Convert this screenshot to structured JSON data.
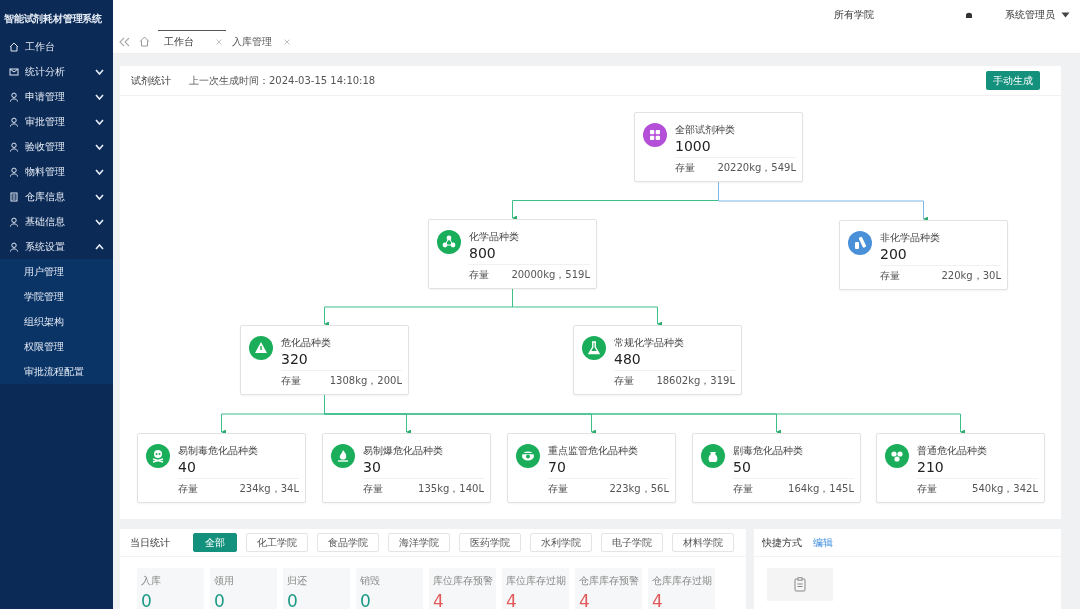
{
  "app_title": "智能试剂耗材管理系统",
  "sidebar": {
    "items": [
      {
        "label": "工作台"
      },
      {
        "label": "统计分析",
        "expanded": false
      },
      {
        "label": "申请管理",
        "expanded": false
      },
      {
        "label": "审批管理",
        "expanded": false
      },
      {
        "label": "验收管理",
        "expanded": false
      },
      {
        "label": "物料管理",
        "expanded": false
      },
      {
        "label": "仓库信息",
        "expanded": false
      },
      {
        "label": "基础信息",
        "expanded": false
      },
      {
        "label": "系统设置",
        "expanded": true,
        "children": [
          {
            "label": "用户管理"
          },
          {
            "label": "学院管理"
          },
          {
            "label": "组织架构"
          },
          {
            "label": "权限管理"
          },
          {
            "label": "审批流程配置"
          }
        ]
      }
    ]
  },
  "header": {
    "college": "所有学院",
    "user": "系统管理员"
  },
  "tabs": [
    {
      "label": "工作台",
      "selected": true
    },
    {
      "label": "入库管理",
      "selected": false
    }
  ],
  "reagent_stats": {
    "title": "试剂统计",
    "last_generated": "上一次生成时间：2024-03-15 14:10:18",
    "button": "手动生成",
    "tree": {
      "label": "全部试剂种类",
      "count": "1000",
      "stock_label": "存量",
      "stock": "20220kg，549L",
      "color": "#b44fd8",
      "children": [
        {
          "label": "化学品种类",
          "count": "800",
          "stock_label": "存量",
          "stock": "20000kg，519L",
          "color": "#1aad5a",
          "children": [
            {
              "label": "危化品种类",
              "count": "320",
              "stock_label": "存量",
              "stock": "1308kg，200L",
              "color": "#1aad5a",
              "children": [
                {
                  "label": "易制毒危化品种类",
                  "count": "40",
                  "stock_label": "存量",
                  "stock": "234kg，34L",
                  "color": "#1aad5a"
                },
                {
                  "label": "易制爆危化品种类",
                  "count": "30",
                  "stock_label": "存量",
                  "stock": "135kg，140L",
                  "color": "#1aad5a"
                },
                {
                  "label": "重点监管危化品种类",
                  "count": "70",
                  "stock_label": "存量",
                  "stock": "223kg，56L",
                  "color": "#1aad5a"
                },
                {
                  "label": "剧毒危化品种类",
                  "count": "50",
                  "stock_label": "存量",
                  "stock": "164kg，145L",
                  "color": "#1aad5a"
                },
                {
                  "label": "普通危化品种类",
                  "count": "210",
                  "stock_label": "存量",
                  "stock": "540kg，342L",
                  "color": "#1aad5a"
                }
              ]
            },
            {
              "label": "常规化学品种类",
              "count": "480",
              "stock_label": "存量",
              "stock": "18602kg，319L",
              "color": "#1aad5a"
            }
          ]
        },
        {
          "label": "非化学品种类",
          "count": "200",
          "stock_label": "存量",
          "stock": "220kg，30L",
          "color": "#4a90d9"
        }
      ]
    }
  },
  "daily_stats": {
    "title": "当日统计",
    "filters": [
      {
        "label": "全部",
        "selected": true
      },
      {
        "label": "化工学院",
        "selected": false
      },
      {
        "label": "食品学院",
        "selected": false
      },
      {
        "label": "海洋学院",
        "selected": false
      },
      {
        "label": "医药学院",
        "selected": false
      },
      {
        "label": "水利学院",
        "selected": false
      },
      {
        "label": "电子学院",
        "selected": false
      },
      {
        "label": "材料学院",
        "selected": false
      }
    ],
    "tiles": [
      {
        "label": "入库",
        "value": "0",
        "color": "#1b9a86"
      },
      {
        "label": "领用",
        "value": "0",
        "color": "#1b9a86"
      },
      {
        "label": "归还",
        "value": "0",
        "color": "#1b9a86"
      },
      {
        "label": "销毁",
        "value": "0",
        "color": "#1b9a86"
      },
      {
        "label": "库位库存预警",
        "value": "4",
        "color": "#e2595a"
      },
      {
        "label": "库位库存过期",
        "value": "4",
        "color": "#e2595a"
      },
      {
        "label": "仓库库存预警",
        "value": "4",
        "color": "#e2595a"
      },
      {
        "label": "仓库库存过期",
        "value": "4",
        "color": "#e2595a"
      }
    ]
  },
  "shortcuts": {
    "title": "快捷方式",
    "edit": "编辑"
  }
}
